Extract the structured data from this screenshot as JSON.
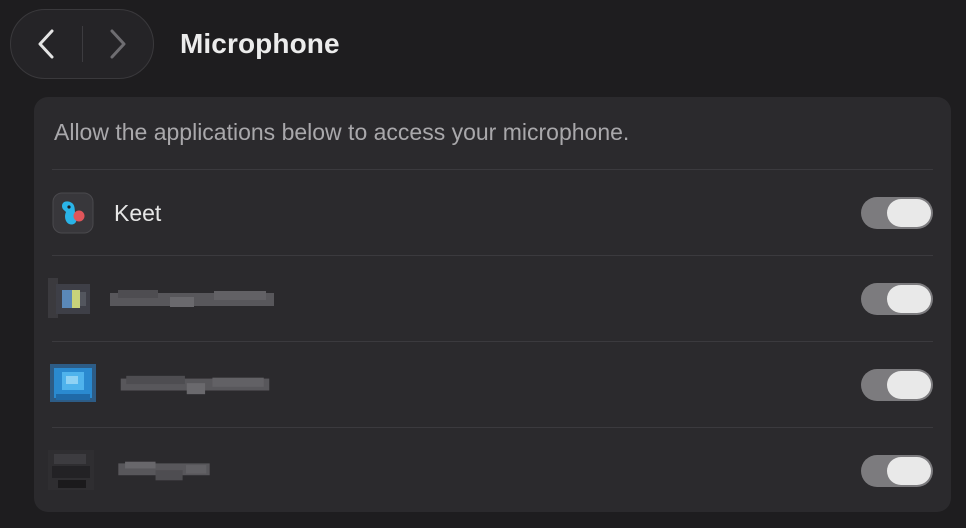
{
  "toolbar": {
    "title": "Microphone",
    "back_icon": "chevron-left-icon",
    "forward_icon": "chevron-right-icon"
  },
  "panel": {
    "description": "Allow the applications below to access your microphone."
  },
  "apps": [
    {
      "name": "Keet",
      "enabled": true,
      "icon": "keet-parrot-icon"
    },
    {
      "name": "",
      "enabled": true,
      "icon": "redacted-app-icon"
    },
    {
      "name": "",
      "enabled": true,
      "icon": "redacted-app-icon"
    },
    {
      "name": "",
      "enabled": true,
      "icon": "redacted-app-icon"
    }
  ],
  "colors": {
    "background": "#1e1d1f",
    "panel": "#2b2a2d",
    "toggle_track": "#7c7b7e",
    "toggle_knob": "#e9e9e9",
    "keet_blue": "#2ab4e8",
    "keet_red": "#e0555a"
  }
}
